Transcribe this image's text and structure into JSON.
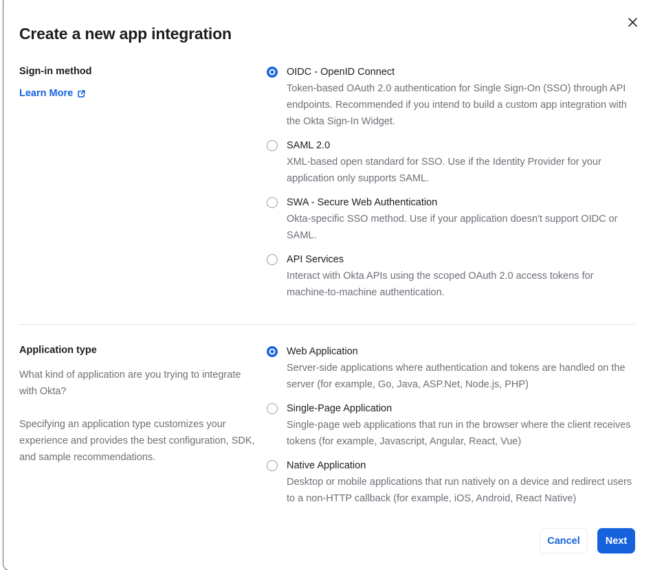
{
  "modal": {
    "title": "Create a new app integration"
  },
  "signin_section": {
    "heading": "Sign-in method",
    "learn_more_label": "Learn More",
    "options": [
      {
        "label": "OIDC - OpenID Connect",
        "description": "Token-based OAuth 2.0 authentication for Single Sign-On (SSO) through API endpoints. Recommended if you intend to build a custom app integration with the Okta Sign-In Widget.",
        "selected": true
      },
      {
        "label": "SAML 2.0",
        "description": "XML-based open standard for SSO. Use if the Identity Provider for your application only supports SAML.",
        "selected": false
      },
      {
        "label": "SWA - Secure Web Authentication",
        "description": "Okta-specific SSO method. Use if your application doesn't support OIDC or SAML.",
        "selected": false
      },
      {
        "label": "API Services",
        "description": "Interact with Okta APIs using the scoped OAuth 2.0 access tokens for machine-to-machine authentication.",
        "selected": false
      }
    ]
  },
  "apptype_section": {
    "heading": "Application type",
    "paragraphs": {
      "p1": "What kind of application are you trying to integrate with Okta?",
      "p2": "Specifying an application type customizes your experience and provides the best configuration, SDK, and sample recommendations."
    },
    "options": [
      {
        "label": "Web Application",
        "description": "Server-side applications where authentication and tokens are handled on the server (for example, Go, Java, ASP.Net, Node.js, PHP)",
        "selected": true
      },
      {
        "label": "Single-Page Application",
        "description": "Single-page web applications that run in the browser where the client receives tokens (for example, Javascript, Angular, React, Vue)",
        "selected": false
      },
      {
        "label": "Native Application",
        "description": "Desktop or mobile applications that run natively on a device and redirect users to a non-HTTP callback (for example, iOS, Android, React Native)",
        "selected": false
      }
    ]
  },
  "footer": {
    "cancel_label": "Cancel",
    "next_label": "Next"
  },
  "icons": {
    "close": "close-icon",
    "external_link": "external-link-icon",
    "radio_selected": "radio-selected-icon",
    "radio_unselected": "radio-unselected-icon"
  },
  "colors": {
    "primary_blue": "#1662dd",
    "text_dark": "#1d1d21",
    "text_gray": "#6e6e78",
    "modal_border": "#64646e",
    "divider": "#e3e3e8",
    "radio_ring": "#9b9ba3"
  }
}
